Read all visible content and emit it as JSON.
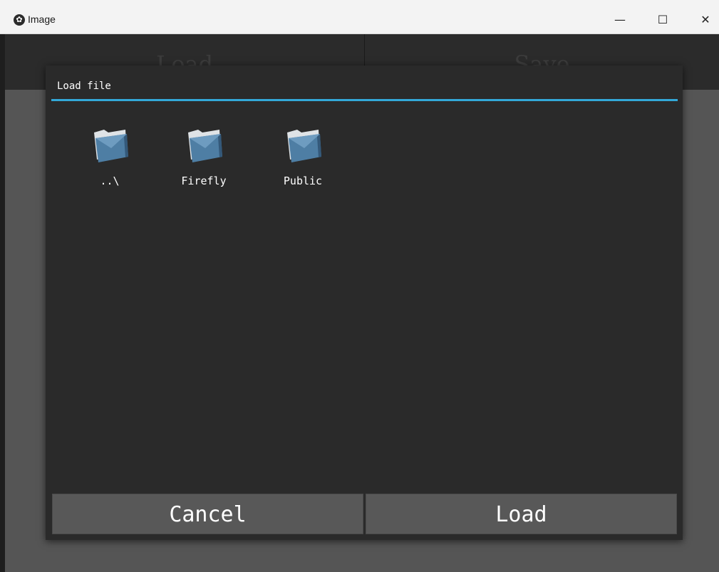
{
  "window": {
    "title": "Image",
    "app_icon": "kivy-logo-icon",
    "controls": {
      "minimize": "—",
      "maximize": "☐",
      "close": "✕"
    }
  },
  "topbar": {
    "load_label": "Load",
    "save_label": "Save"
  },
  "dialog": {
    "title": "Load file",
    "accent_color": "#33a8d8",
    "files": [
      {
        "name": "..\\",
        "icon": "folder-icon"
      },
      {
        "name": "Firefly",
        "icon": "folder-icon"
      },
      {
        "name": "Public",
        "icon": "folder-icon"
      }
    ],
    "cancel_label": "Cancel",
    "load_label": "Load"
  }
}
